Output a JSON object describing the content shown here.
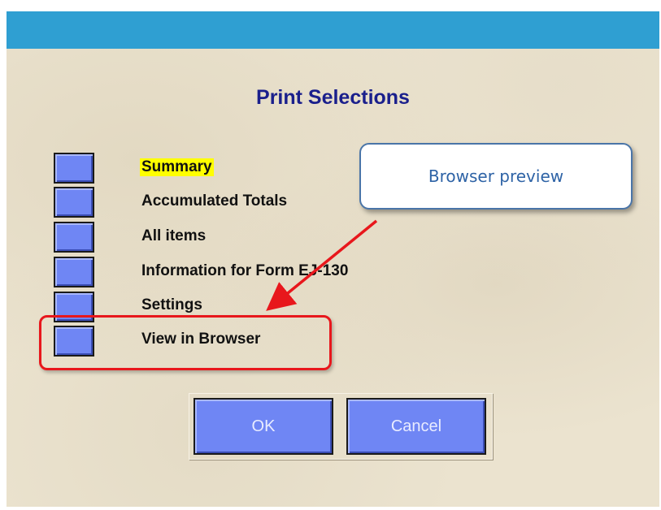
{
  "dialog": {
    "title": "Print Selections"
  },
  "options": [
    {
      "label": "Summary",
      "highlighted": true
    },
    {
      "label": "Accumulated Totals",
      "highlighted": false
    },
    {
      "label": "All items",
      "highlighted": false
    },
    {
      "label": "Information for Form EJ-130",
      "highlighted": false
    },
    {
      "label": "Settings",
      "highlighted": false
    },
    {
      "label": "View in Browser",
      "highlighted": false
    }
  ],
  "buttons": {
    "ok_label": "OK",
    "cancel_label": "Cancel"
  },
  "annotation": {
    "callout_text": "Browser preview"
  },
  "colors": {
    "titlebar": "#2f9fd2",
    "title_text": "#1a1f8c",
    "button_fill": "#6f86f4",
    "highlight_label": "#ffff00",
    "annotation_red": "#e8171c",
    "callout_text": "#2e63a6"
  }
}
